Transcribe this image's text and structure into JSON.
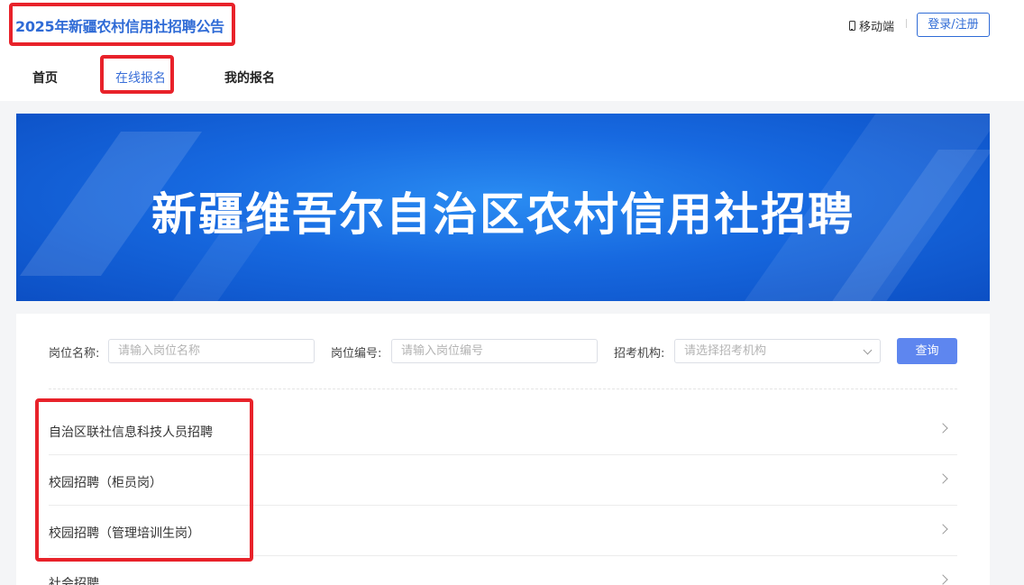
{
  "header": {
    "site_title": "2025年新疆农村信用社招聘公告",
    "mobile_label": "移动端",
    "login_label": "登录/注册"
  },
  "nav": {
    "home": "首页",
    "online_apply": "在线报名",
    "my_apply": "我的报名"
  },
  "banner": {
    "title": "新疆维吾尔自治区农村信用社招聘"
  },
  "filters": {
    "position_name_label": "岗位名称:",
    "position_name_placeholder": "请输入岗位名称",
    "position_code_label": "岗位编号:",
    "position_code_placeholder": "请输入岗位编号",
    "org_label": "招考机构:",
    "org_placeholder": "请选择招考机构",
    "query_label": "查询"
  },
  "list": [
    {
      "label": "自治区联社信息科技人员招聘"
    },
    {
      "label": "校园招聘（柜员岗）"
    },
    {
      "label": "校园招聘（管理培训生岗）"
    },
    {
      "label": "社会招聘"
    }
  ],
  "colors": {
    "accent": "#2f6bd6",
    "annotation": "#e8222a",
    "query_button": "#5e86ef"
  }
}
